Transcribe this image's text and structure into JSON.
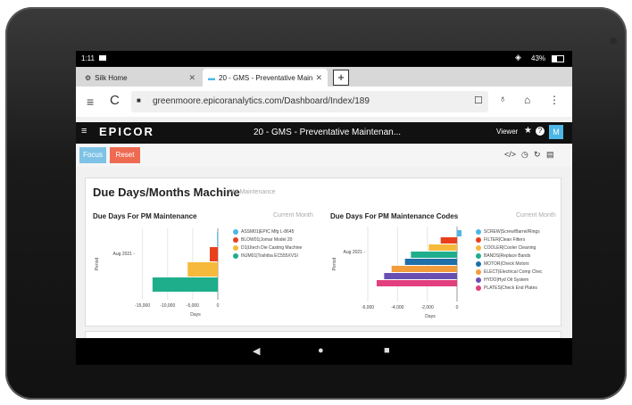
{
  "status_bar": {
    "time": "1:11",
    "battery": "43%"
  },
  "browser": {
    "tabs": [
      {
        "label": "Silk Home",
        "close": "✕"
      },
      {
        "label": "20 - GMS - Preventative Main",
        "close": "✕"
      }
    ],
    "new_tab": "+",
    "url": "greenmoore.epicoranalytics.com/Dashboard/Index/189"
  },
  "app": {
    "logo": "EPICOR",
    "page_title": "20 - GMS - Preventative Maintenan...",
    "viewer_label": "Viewer",
    "user_initial": "M"
  },
  "toolbar": {
    "focus_label": "Focus",
    "reset_label": "Reset"
  },
  "panel": {
    "title": "Due Days/Months Machine",
    "subtitle": "PM Maintenance"
  },
  "chart_data": [
    {
      "type": "bar",
      "orientation": "horizontal",
      "title": "Due Days For PM Maintenance",
      "subtitle": "Current Month",
      "xlabel": "Days",
      "ylabel": "Period",
      "y_tick": "Aug 2021 -",
      "x_ticks": [
        "-15,000",
        "-10,000",
        "-5,000",
        "0"
      ],
      "xlim": [
        -16000,
        0
      ],
      "series": [
        {
          "name": "ASSM01|EPIC Mfg L-8645",
          "color": "#4db6e6",
          "value": -150
        },
        {
          "name": "BLOW01|Jomar Model 20",
          "color": "#e8401c",
          "value": -1600
        },
        {
          "name": "D1|Utech Die Casting Machine",
          "color": "#f6b93b",
          "value": -6000
        },
        {
          "name": "INJM01|Toshiba EC555XVSI",
          "color": "#1fae8c",
          "value": -13000
        }
      ]
    },
    {
      "type": "bar",
      "orientation": "horizontal",
      "title": "Due Days For PM Maintenance Codes",
      "subtitle": "Current Month",
      "xlabel": "Days",
      "ylabel": "Period",
      "y_tick": "Aug 2021 -",
      "x_ticks": [
        "-6,000",
        "-4,000",
        "-2,000",
        "0"
      ],
      "xlim": [
        -6000,
        0
      ],
      "series": [
        {
          "name": "SCREW|Screw/Barrel/Rings",
          "color": "#4db6e6",
          "value": 300
        },
        {
          "name": "FILTER|Clean Filters",
          "color": "#e8401c",
          "value": -1100
        },
        {
          "name": "COOLER|Cooler Cleaning",
          "color": "#f6b93b",
          "value": -1900
        },
        {
          "name": "BANDS|Replace Bands",
          "color": "#1fae8c",
          "value": -3100
        },
        {
          "name": "MOTOR|Check Motors",
          "color": "#1f6fa8",
          "value": -3500
        },
        {
          "name": "ELECT|Electrical Comp Chec",
          "color": "#f39c3c",
          "value": -4400
        },
        {
          "name": "HYDO|Hyd Oil System",
          "color": "#6a4fb3",
          "value": -4900
        },
        {
          "name": "PLATES|Check End Plates",
          "color": "#e23f7e",
          "value": -5400
        }
      ]
    }
  ]
}
